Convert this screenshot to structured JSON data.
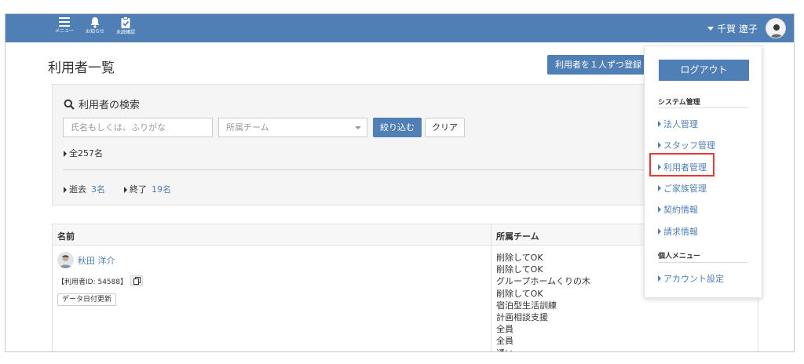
{
  "header": {
    "nav": [
      {
        "label": "メニュー",
        "icon": "hamburger-icon"
      },
      {
        "label": "お知らせ",
        "icon": "bell-icon"
      },
      {
        "label": "未読確認",
        "icon": "clipboard-check-icon"
      }
    ],
    "user_name": "千賀 遼子"
  },
  "page": {
    "title": "利用者一覧",
    "register_button": "利用者を１人ずつ登録"
  },
  "search": {
    "title": "利用者の検索",
    "name_placeholder": "氏名もしくは、ふりがな",
    "team_placeholder": "所属チーム",
    "filter_button": "絞り込む",
    "clear_button": "クリア",
    "total": "全257名",
    "status": [
      {
        "label": "逝去",
        "count": "3名"
      },
      {
        "label": "終了",
        "count": "19名"
      }
    ]
  },
  "table": {
    "headers": [
      "名前",
      "所属チーム"
    ],
    "row": {
      "name": "秋田 洋介",
      "user_id": "【利用者ID: 54588】",
      "data_update": "データ日付更新",
      "teams": [
        "削除してOK",
        "削除してOK",
        "グループホームくりの木",
        "削除してOK",
        "宿泊型生活訓練",
        "計画相談支援",
        "全員",
        "全員",
        "通い"
      ]
    }
  },
  "dropdown": {
    "logout": "ログアウト",
    "system_heading": "システム管理",
    "system_items": [
      "法人管理",
      "スタッフ管理",
      "利用者管理",
      "ご家族管理",
      "契約情報",
      "請求情報"
    ],
    "personal_heading": "個人メニュー",
    "personal_items": [
      "アカウント設定"
    ]
  },
  "colors": {
    "primary": "#4f7fb4",
    "highlight": "#e53935"
  }
}
